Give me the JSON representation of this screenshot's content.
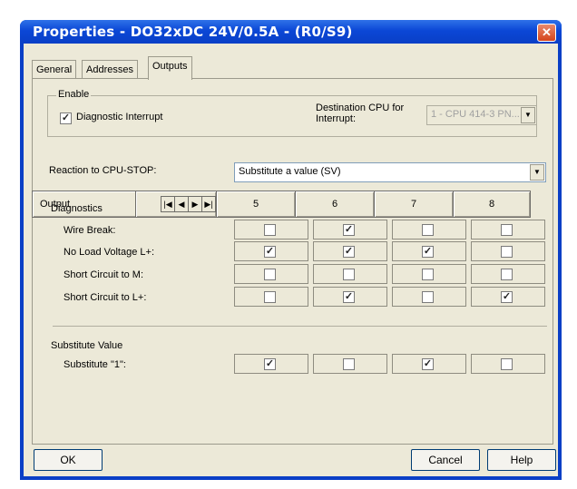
{
  "window": {
    "title": "Properties - DO32xDC 24V/0.5A - (R0/S9)",
    "close_glyph": "✕"
  },
  "tabs": [
    {
      "label": "General"
    },
    {
      "label": "Addresses"
    },
    {
      "label": "Outputs"
    }
  ],
  "enable": {
    "legend": "Enable",
    "diagnostic_interrupt": {
      "label": "Diagnostic Interrupt",
      "checked": true
    },
    "destination_cpu_label": "Destination CPU for Interrupt:",
    "destination_cpu_value": "1 - CPU 414-3 PN..."
  },
  "reaction": {
    "label": "Reaction to CPU-STOP:",
    "value": "Substitute a value (SV)"
  },
  "grid": {
    "output_label": "Output",
    "nav": [
      "|◀",
      "◀",
      "▶",
      "▶|"
    ],
    "columns": [
      "5",
      "6",
      "7",
      "8"
    ],
    "diagnostics_label": "Diagnostics",
    "diagnostic_rows": [
      {
        "label": "Wire Break:",
        "checks": [
          false,
          true,
          false,
          false
        ]
      },
      {
        "label": "No Load Voltage L+:",
        "checks": [
          true,
          true,
          true,
          false
        ]
      },
      {
        "label": "Short Circuit to M:",
        "checks": [
          false,
          false,
          false,
          false
        ]
      },
      {
        "label": "Short Circuit to L+:",
        "checks": [
          false,
          true,
          false,
          true
        ]
      }
    ],
    "substitute_label": "Substitute Value",
    "substitute_row": {
      "label": "Substitute \"1\":",
      "checks": [
        true,
        false,
        true,
        false
      ]
    }
  },
  "buttons": {
    "ok": "OK",
    "cancel": "Cancel",
    "help": "Help"
  },
  "check_glyph": "✓",
  "colors": {
    "titlebar": "#0a3fc6",
    "dialog_bg": "#ece9d8",
    "close": "#d5451d"
  }
}
